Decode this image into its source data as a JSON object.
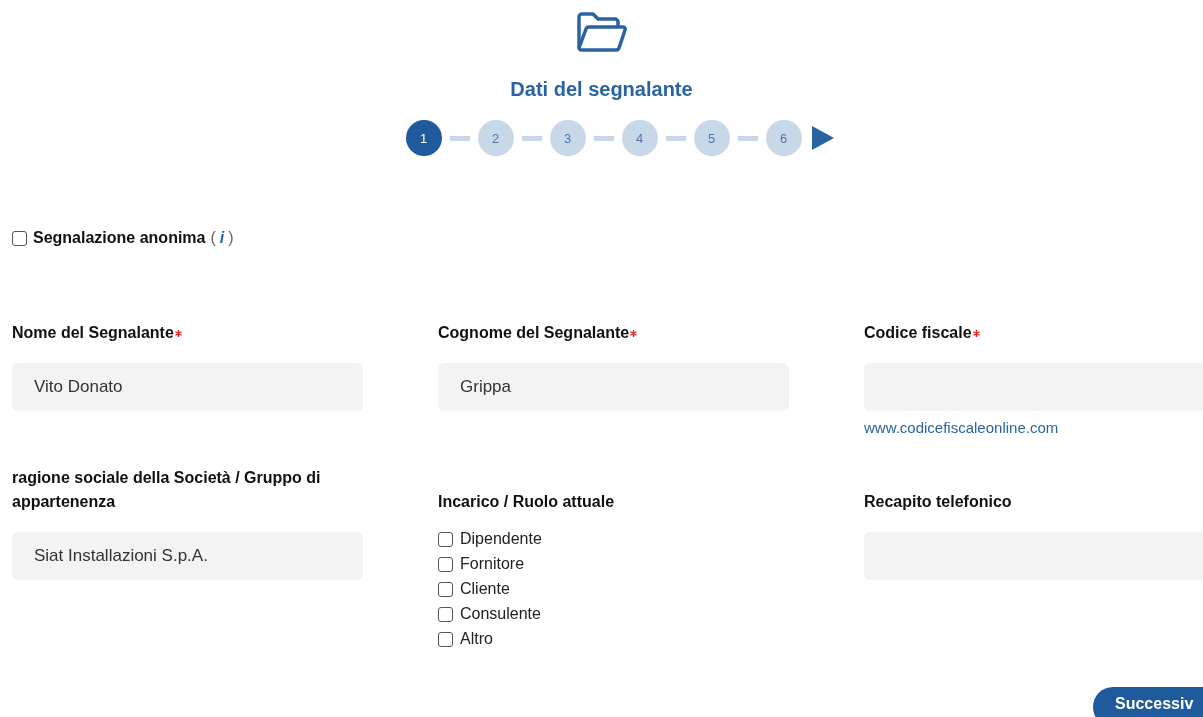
{
  "header": {
    "title": "Dati del segnalante"
  },
  "steps": [
    {
      "label": "1",
      "selected": true
    },
    {
      "label": "2",
      "selected": false
    },
    {
      "label": "3",
      "selected": false
    },
    {
      "label": "4",
      "selected": false
    },
    {
      "label": "5",
      "selected": false
    },
    {
      "label": "6",
      "selected": false
    }
  ],
  "anonymous": {
    "label": "Segnalazione anonima",
    "info": "(*i*)",
    "checked": false
  },
  "fields": [
    {
      "kind": "text",
      "label": "Nome del Segnalante",
      "required": true,
      "value": "Vito Donato"
    },
    {
      "kind": "text",
      "label": "Cognome del Segnalante",
      "required": true,
      "value": "Grippa"
    },
    {
      "kind": "text",
      "label": "Codice fiscale",
      "required": true,
      "link": "www.codicefiscaleonline.com"
    },
    {
      "kind": "text",
      "label": "ragione sociale della Società / Gruppo di appartenenza",
      "required": false,
      "value": "Siat Installazioni S.p.A."
    },
    {
      "kind": "checkboxes",
      "label": "Incarico / Ruolo attuale",
      "required": false,
      "options": [
        {
          "label": "Dipendente",
          "checked": false
        },
        {
          "label": "Fornitore",
          "checked": false
        },
        {
          "label": "Cliente",
          "checked": false
        },
        {
          "label": "Consulente",
          "checked": false
        },
        {
          "label": "Altro",
          "checked": false
        }
      ]
    },
    {
      "kind": "text",
      "label": "Recapito telefonico",
      "required": false
    }
  ],
  "next_button": "Successiv"
}
